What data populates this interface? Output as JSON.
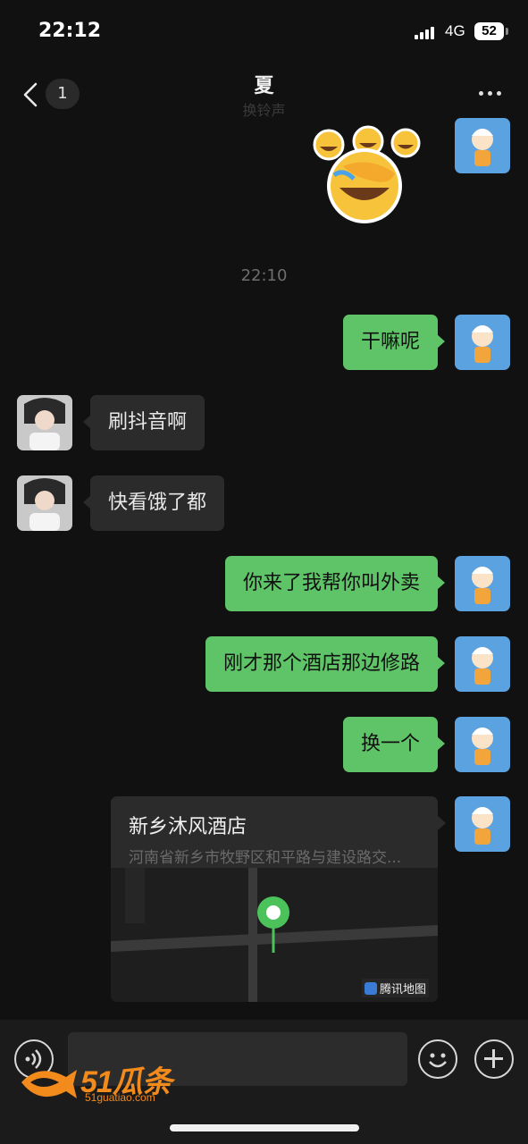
{
  "status_bar": {
    "time": "22:12",
    "network": "4G",
    "battery": "52"
  },
  "header": {
    "back_badge": "1",
    "title": "夏",
    "subtitle": "换铃声"
  },
  "messages": {
    "timestamp": "22:10",
    "items": [
      {
        "side": "out",
        "text": "干嘛呢"
      },
      {
        "side": "in",
        "text": "刷抖音啊"
      },
      {
        "side": "in",
        "text": "快看饿了都"
      },
      {
        "side": "out",
        "text": "你来了我帮你叫外卖"
      },
      {
        "side": "out",
        "text": "刚才那个酒店那边修路"
      },
      {
        "side": "out",
        "text": "换一个"
      }
    ]
  },
  "location": {
    "name": "新乡沐风酒店",
    "address": "河南省新乡市牧野区和平路与建设路交...",
    "map_brand": "腾讯地图"
  },
  "watermark": {
    "text": "51瓜条",
    "subtext": "51guatiao.com"
  },
  "colors": {
    "outgoing_bubble": "#5fc467",
    "incoming_bubble": "#2b2b2b",
    "background": "#111111"
  }
}
